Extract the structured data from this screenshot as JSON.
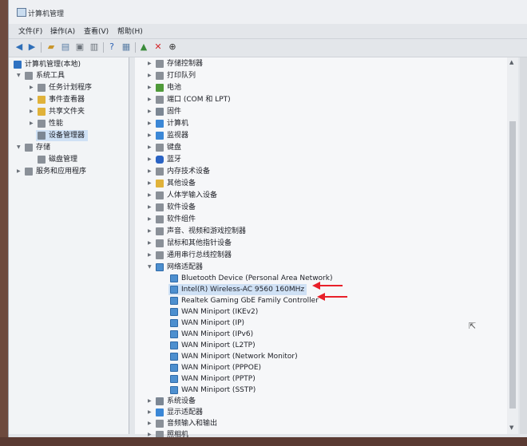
{
  "window": {
    "title": "计算机管理"
  },
  "menu": [
    "文件(F)",
    "操作(A)",
    "查看(V)",
    "帮助(H)"
  ],
  "toolbar_icons": [
    "back-icon",
    "forward-icon",
    "up-folder-icon",
    "show-hide-tree-icon",
    "properties-icon",
    "help-icon",
    "view-icon",
    "scan-monitor-icon",
    "update-driver-icon",
    "uninstall-icon",
    "download-icon"
  ],
  "left_tree": [
    {
      "label": "计算机管理(本地)",
      "level": 0
    },
    {
      "label": "系统工具",
      "level": 1
    },
    {
      "label": "任务计划程序",
      "level": 2
    },
    {
      "label": "事件查看器",
      "level": 2
    },
    {
      "label": "共享文件夹",
      "level": 2
    },
    {
      "label": "性能",
      "level": 2
    },
    {
      "label": "设备管理器",
      "level": 2,
      "selected": true
    },
    {
      "label": "存储",
      "level": 1
    },
    {
      "label": "磁盘管理",
      "level": 2
    },
    {
      "label": "服务和应用程序",
      "level": 1
    }
  ],
  "device_categories_top": [
    "存储控制器",
    "打印队列",
    "电池",
    "端口 (COM 和 LPT)",
    "固件",
    "计算机",
    "监视器",
    "键盘",
    "蓝牙",
    "内存技术设备",
    "其他设备",
    "人体学输入设备",
    "软件设备",
    "软件组件",
    "声音、视频和游戏控制器",
    "鼠标和其他指针设备",
    "通用串行总线控制器"
  ],
  "network_adapters": {
    "label": "网络适配器",
    "items": [
      "Bluetooth Device (Personal Area Network)",
      "Intel(R) Wireless-AC 9560 160MHz",
      "Realtek Gaming GbE Family Controller",
      "WAN Miniport (IKEv2)",
      "WAN Miniport (IP)",
      "WAN Miniport (IPv6)",
      "WAN Miniport (L2TP)",
      "WAN Miniport (Network Monitor)",
      "WAN Miniport (PPPOE)",
      "WAN Miniport (PPTP)",
      "WAN Miniport (SSTP)"
    ]
  },
  "device_categories_bottom": [
    "系统设备",
    "显示适配器",
    "音频输入和输出",
    "照相机"
  ],
  "colors": {
    "annotation_arrow": "#e8202a",
    "selection": "#cfe1f5"
  }
}
